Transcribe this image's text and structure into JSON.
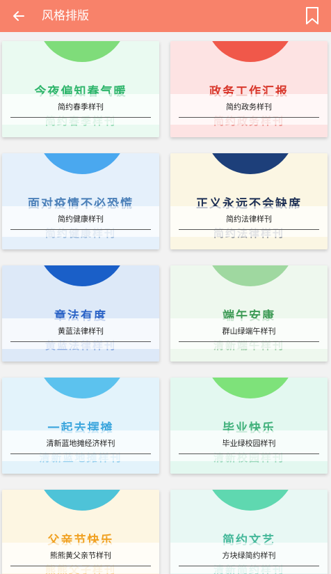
{
  "header": {
    "title": "风格排版",
    "back_icon": "arrow-left-icon",
    "bookmark_icon": "bookmark-icon",
    "bg_color": "#f8826a"
  },
  "templates": [
    {
      "label": "简约春季样刊",
      "headline": "今夜偏知春气暖",
      "ghost": "简约春季样刊",
      "bg": "#eafaf1",
      "circle": "#7fdc7a",
      "text": "#2eb56b"
    },
    {
      "label": "简约政务样刊",
      "headline": "政务工作汇报",
      "ghost": "简约政务样刊",
      "bg": "#fde3e3",
      "circle": "#f0584a",
      "text": "#d8362a"
    },
    {
      "label": "简约健康样刊",
      "headline": "面对疫情不必恐慌",
      "ghost": "简约健康样刊",
      "bg": "#e5f0fb",
      "circle": "#4aa8ef",
      "text": "#4a7fb8"
    },
    {
      "label": "简约法律样刊",
      "headline": "正义永远不会缺席",
      "ghost": "简约法律样刊",
      "bg": "#fbf6e3",
      "circle": "#1d3f7a",
      "text": "#1d2f55"
    },
    {
      "label": "黄蓝法律样刊",
      "headline": "章法有度",
      "ghost": "黄蓝法律样刊",
      "bg": "#dde9f8",
      "circle": "#1a5fc8",
      "text": "#2b63c6"
    },
    {
      "label": "群山绿端午样刊",
      "headline": "端午安康",
      "ghost": "清新端午样刊",
      "bg": "#eef8ee",
      "circle": "#9fd8a0",
      "text": "#3d9a55"
    },
    {
      "label": "清新蓝地摊经济样刊",
      "headline": "一起去摆摊",
      "ghost": "清新蓝地摊样刊",
      "bg": "#e3f3fb",
      "circle": "#5cc2ee",
      "text": "#3aa5dd"
    },
    {
      "label": "毕业绿校园样刊",
      "headline": "毕业快乐",
      "ghost": "清新校园样刊",
      "bg": "#e3f8f0",
      "circle": "#7ee27a",
      "text": "#3fb07a"
    },
    {
      "label": "熊熊黄父亲节样刊",
      "headline": "父亲节快乐",
      "ghost": "熊熊父子样刊",
      "bg": "#fdf6e2",
      "circle": "#4ec3d8",
      "text": "#f0a020"
    },
    {
      "label": "方块绿简约样刊",
      "headline": "简约文艺",
      "ghost": "清新简约样刊",
      "bg": "#e8f8f4",
      "circle": "#5fd8b0",
      "text": "#45b89a"
    }
  ]
}
